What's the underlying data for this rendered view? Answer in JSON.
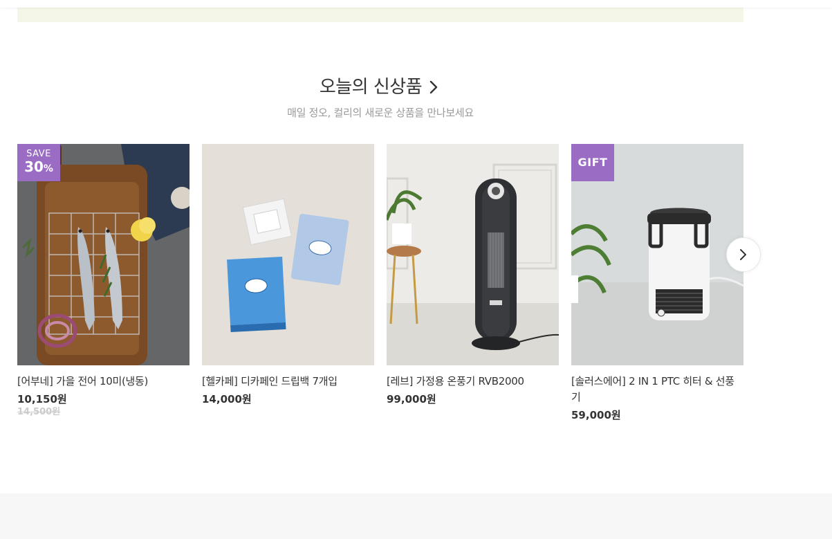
{
  "section": {
    "title": "오늘의 신상품",
    "subtitle": "매일 정오, 컬리의 새로운 상품을 만나보세요"
  },
  "products": [
    {
      "name": "[어부네] 가을 전어 10미(냉동)",
      "price": "10,150원",
      "original_price": "14,500원",
      "badge": {
        "type": "save",
        "label": "SAVE",
        "value": "30",
        "unit": "%"
      }
    },
    {
      "name": "[헬카페] 디카페인 드립백 7개입",
      "price": "14,000원"
    },
    {
      "name": "[레브] 가정용 온풍기 RVB2000",
      "price": "99,000원"
    },
    {
      "name": "[솔러스에어] 2 IN 1 PTC 히터 & 선풍기",
      "price": "59,000원",
      "badge": {
        "type": "gift",
        "label": "GIFT"
      }
    }
  ],
  "controls": {
    "next_icon": "chevron-right-icon",
    "title_icon": "chevron-right-icon"
  },
  "colors": {
    "badge_purple": "#9a6cc3",
    "banner_tint": "#f4f6e8",
    "footer_gray": "#f7f7f7",
    "subtitle_gray": "#999999",
    "strike_gray": "#cccccc"
  }
}
